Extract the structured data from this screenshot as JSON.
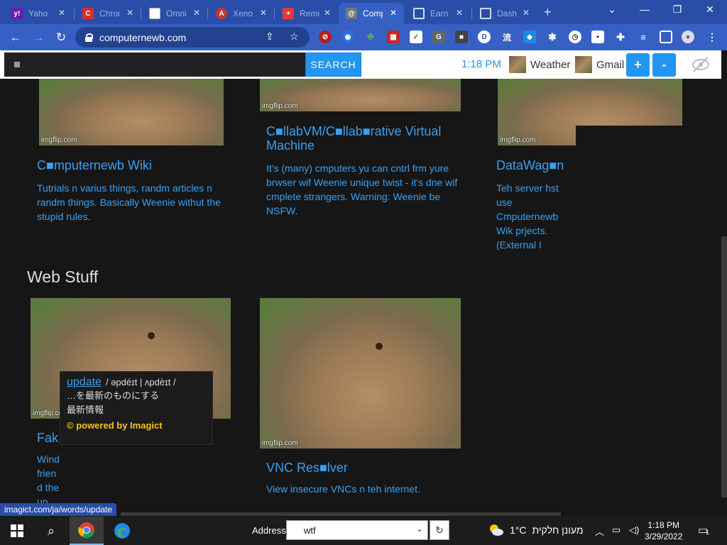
{
  "tabs": [
    {
      "title": "Yahoo",
      "fav": "y!",
      "color": "#6a1bb1"
    },
    {
      "title": "Chrome",
      "fav": "C",
      "color": "#d32f2f"
    },
    {
      "title": "Omni",
      "fav": "",
      "color": "#ffffff"
    },
    {
      "title": "Xeno",
      "fav": "A",
      "color": "#c0392b"
    },
    {
      "title": "Remote",
      "fav": "+",
      "color": "#e53935"
    },
    {
      "title": "Comp",
      "fav": "@",
      "color": "#555555"
    },
    {
      "title": "Earn",
      "fav": "",
      "color": "#2a4ea7"
    },
    {
      "title": "Dash",
      "fav": "",
      "color": "#2a4ea7"
    }
  ],
  "browser": {
    "url": "computernewb.com"
  },
  "topbar": {
    "search_button": "SEARCH",
    "time": "1:18 PM",
    "links": [
      "Weather",
      "Gmail"
    ],
    "zoom_in": "+",
    "zoom_out": "-"
  },
  "cards_row1": [
    {
      "title": "C■mputernewb Wiki",
      "desc": "Tutrials n varius things, randm articles n randm things. Basically Weenie withut the stupid rules.",
      "watermark": "imgflip.com"
    },
    {
      "title": "C■llabVM/C■llab■rative Virtual Machine",
      "desc": "It's (many) cmputers yu can cntrl frm yure brwser wif Weenie unique twist - it's dne wif cmplete strangers. Warning: Weenie be NSFW.",
      "watermark": "imgflip.com"
    },
    {
      "title": "DataWag■n",
      "desc": "Teh server hst use Cmputernewb Wik prjects. (External I",
      "watermark": "imgflip.com"
    }
  ],
  "section_title": "Web Stuff",
  "cards_row2": [
    {
      "title": "Fak",
      "desc": "Wind friend the up",
      "watermark": "imgflip.com"
    },
    {
      "title": "VNC Res■lver",
      "desc": "View insecure VNCs n teh internet.",
      "watermark": "imgflip.com"
    }
  ],
  "popup": {
    "word": "update",
    "phonetic": "/ əpdéɪt | ʌpdèɪt /",
    "meaning1": "…を最新のものにする",
    "meaning2": "最新情報",
    "powered": "© powered by Imagict"
  },
  "status_url": "imagict.com/ja/words/update",
  "taskbar": {
    "address_label": "Address",
    "address_value": "wtf",
    "temperature": "1°C",
    "weather_desc": "מעונן חלקית",
    "time": "1:18 PM",
    "date": "3/29/2022",
    "notifications": "1"
  }
}
